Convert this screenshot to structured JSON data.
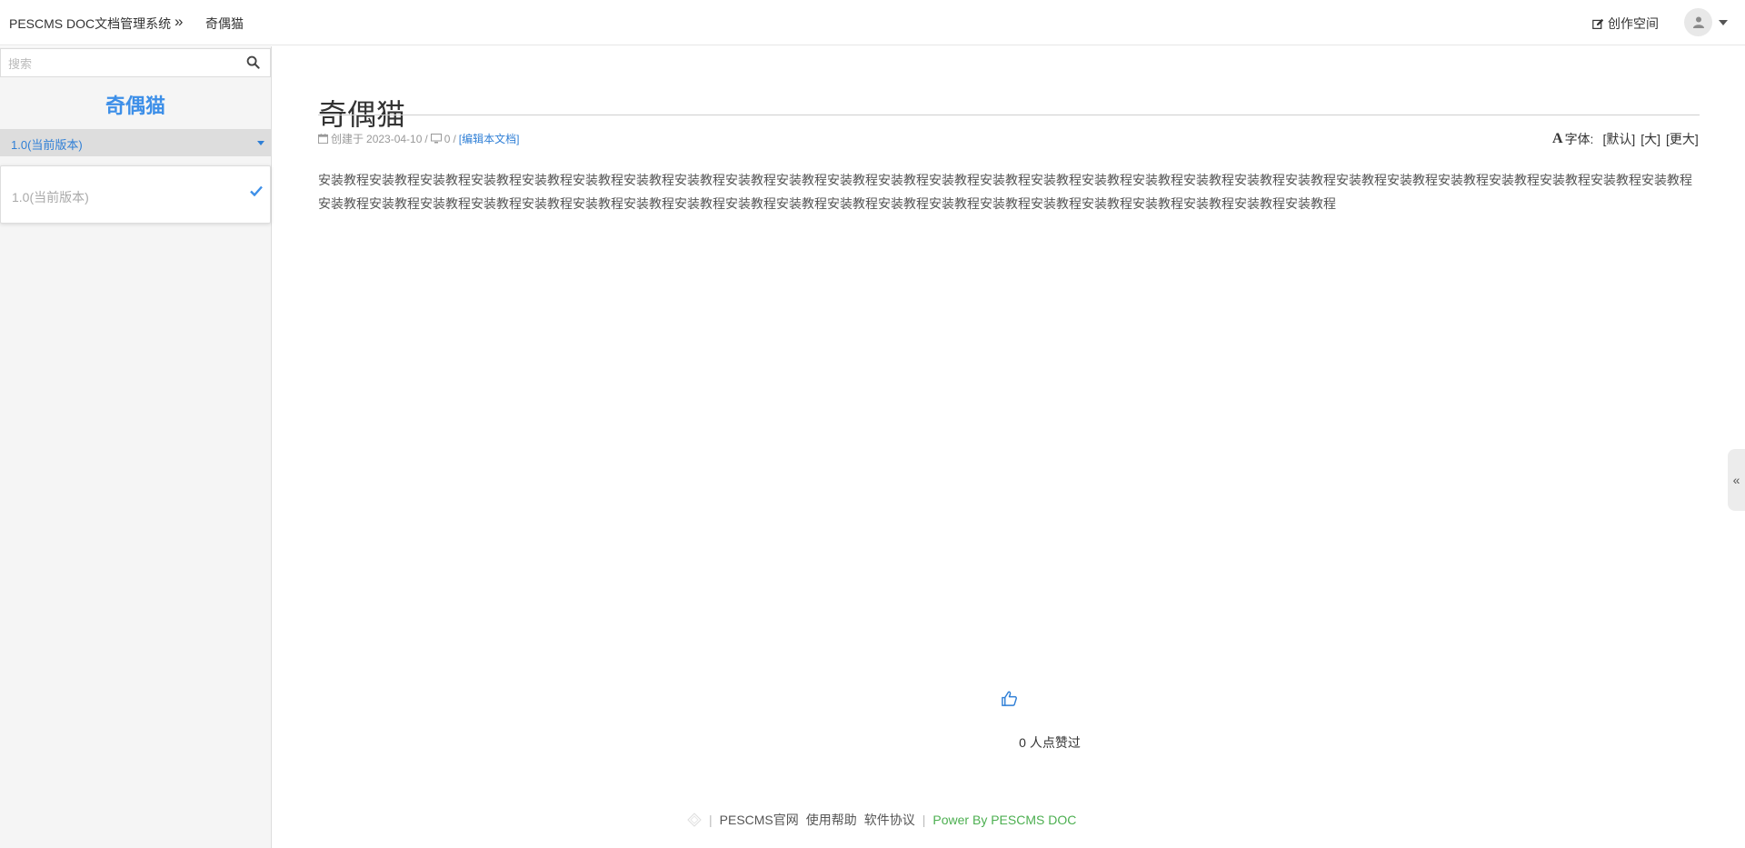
{
  "header": {
    "brand": "PESCMS DOC文档管理系统",
    "breadcrumb_sep": "»",
    "breadcrumb_current": "奇偶猫",
    "create_space": "创作空间"
  },
  "sidebar": {
    "search_placeholder": "搜索",
    "title": "奇偶猫",
    "version_selected": "1.0(当前版本)",
    "version_options": [
      "1.0(当前版本)"
    ]
  },
  "doc": {
    "title": "奇偶猫",
    "created_label": "创建于",
    "created_date": "2023-04-10",
    "view_count": "0",
    "edit_link": "[编辑本文档]",
    "font_label": "字体:",
    "font_options": [
      "[默认]",
      "[大]",
      "[更大]"
    ],
    "body": "安装教程安装教程安装教程安装教程安装教程安装教程安装教程安装教程安装教程安装教程安装教程安装教程安装教程安装教程安装教程安装教程安装教程安装教程安装教程安装教程安装教程安装教程安装教程安装教程安装教程安装教程安装教程安装教程安装教程安装教程安装教程安装教程安装教程安装教程安装教程安装教程安装教程安装教程安装教程安装教程安装教程安装教程安装教程安装教程安装教程安装教程安装教程",
    "like_text": "0 人点赞过"
  },
  "footer": {
    "links": [
      "PESCMS官网",
      "使用帮助",
      "软件协议"
    ],
    "power": "Power By PESCMS DOC"
  },
  "colors": {
    "accent": "#3d8fe8",
    "link": "#2f7fd6",
    "power": "#4caf50"
  }
}
